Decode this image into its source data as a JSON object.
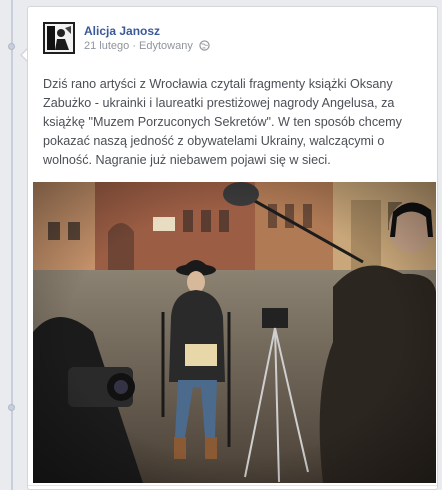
{
  "post": {
    "author_name": "Alicja Janosz",
    "date": "21 lutego",
    "separator": " · ",
    "edited_label": "Edytowany",
    "body_text": "Dziś rano artyści z Wrocławia czytali fragmenty książki Oksany Zabużko - ukrainki i laureatki prestiżowej nagrody Angelusa, za książkę \"Muzem Porzuconych Sekretów\". W ten sposób chcemy pokazać naszą jedność z obywatelami Ukrainy, walczącymi o wolność. Nagranie już niebawem pojawi się w sieci."
  },
  "icons": {
    "privacy": "globe-icon"
  },
  "colors": {
    "author_link": "#3b5998",
    "meta_text": "#90949c",
    "body_text": "#4b4f56",
    "page_background": "#e9ebee"
  }
}
